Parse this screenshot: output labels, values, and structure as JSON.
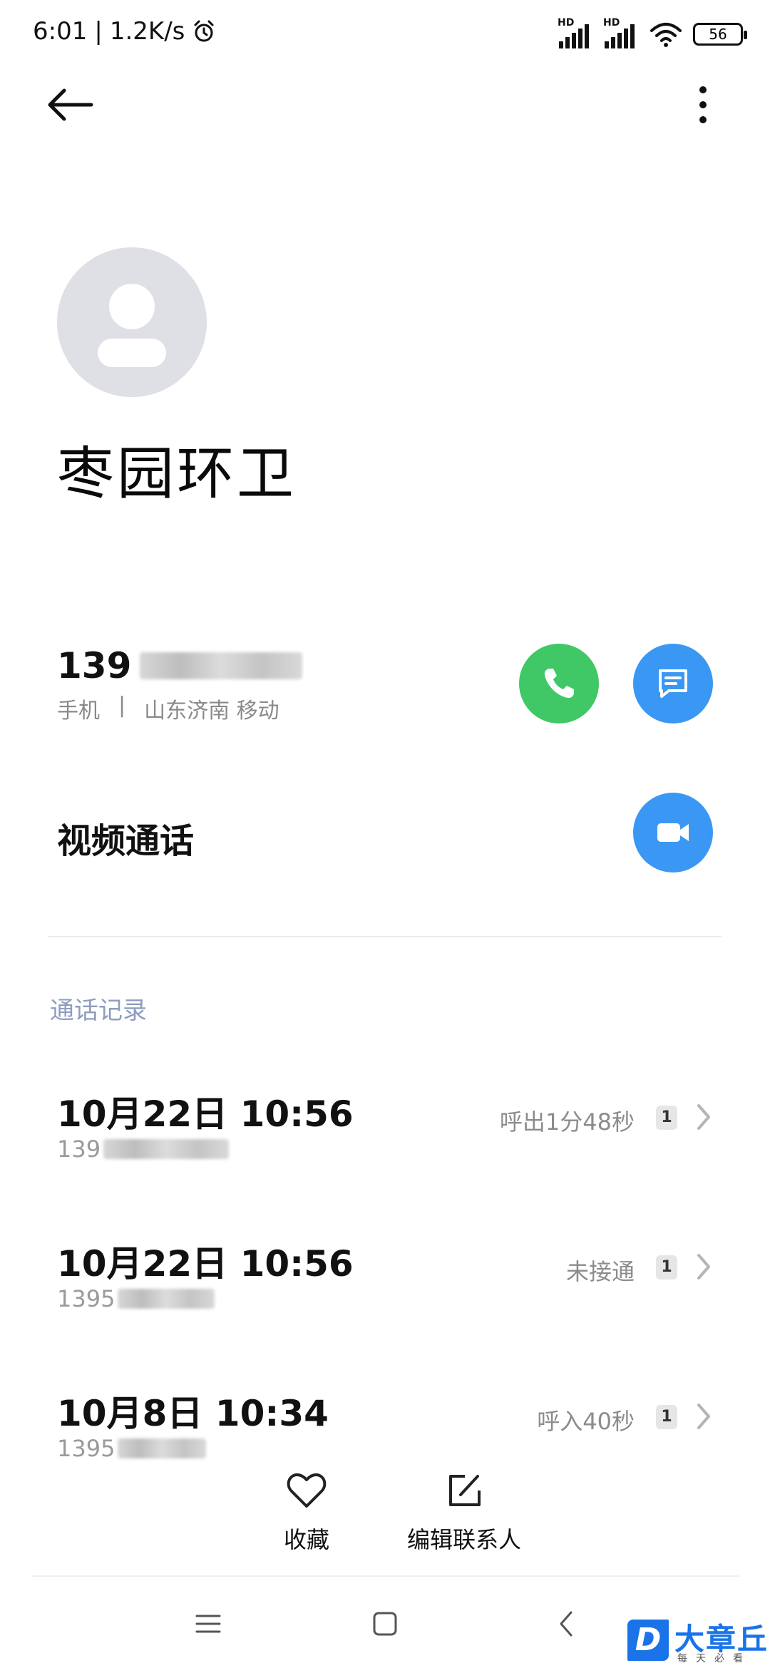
{
  "status_bar": {
    "time": "6:01",
    "net_speed": "1.2K/s",
    "sim1_label": "HD",
    "sim2_label": "HD",
    "battery": "56"
  },
  "contact": {
    "name": "枣园环卫",
    "phone_prefix": "139",
    "phone_type": "手机",
    "separator": "|",
    "location": "山东济南 移动"
  },
  "actions": {
    "video_call_label": "视频通话"
  },
  "call_log": {
    "title": "通话记录",
    "entries": [
      {
        "date": "10月22日 10:56",
        "number_prefix": "139",
        "status": "呼出1分48秒",
        "count": "1"
      },
      {
        "date": "10月22日 10:56",
        "number_prefix": "1395",
        "status": "未接通",
        "count": "1"
      },
      {
        "date": "10月8日 10:34",
        "number_prefix": "1395",
        "status": "呼入40秒",
        "count": "1"
      }
    ]
  },
  "bottom_bar": {
    "favorite_label": "收藏",
    "edit_label": "编辑联系人"
  },
  "watermark": {
    "logo_letter": "D",
    "brand": "大章丘",
    "slogan": "每天必看"
  },
  "colors": {
    "call_green": "#3fc865",
    "accent_blue": "#3a98f4",
    "section_title": "#8f9cbf",
    "avatar_bg": "#dfe0e6"
  }
}
